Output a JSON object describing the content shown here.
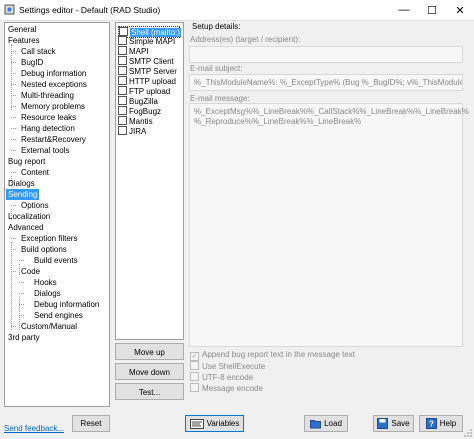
{
  "window": {
    "title": "Settings editor - Default (RAD Studio)"
  },
  "tree": {
    "items": [
      "General",
      "Features",
      "Call stack",
      "BugID",
      "Debug information",
      "Nested exceptions",
      "Multi-threading",
      "Memory problems",
      "Resource leaks",
      "Hang detection",
      "Restart&Recovery",
      "External tools",
      "Bug report",
      "Content",
      "Dialogs",
      "Sending",
      "Options",
      "Localization",
      "Advanced",
      "Exception filters",
      "Build options",
      "Build events",
      "Code",
      "Hooks",
      "Dialogs",
      "Debug information",
      "Send engines",
      "Custom/Manual",
      "3rd party"
    ],
    "selected": "Sending"
  },
  "plugins": {
    "items": [
      "Shell (mailto:)",
      "Simple MAPI",
      "MAPI",
      "SMTP Client",
      "SMTP Server",
      "HTTP upload",
      "FTP upload",
      "BugZilla",
      "FogBugz",
      "Mantis",
      "JIRA"
    ],
    "selected": "Shell (mailto:)"
  },
  "buttons": {
    "move_up": "Move up",
    "move_down": "Move down",
    "test": "Test...",
    "reset": "Reset",
    "variables": "Variables",
    "load": "Load",
    "save": "Save",
    "help": "Help"
  },
  "setup": {
    "heading": "Setup details:",
    "address_label": "Address(es) (target / recipient):",
    "address_value": "",
    "subject_label": "E-mail subject:",
    "subject_value": "%_ThisModuleName%: %_ExceptType% (Bug %_BugID%; v%_ThisModuleVer%)",
    "message_label": "E-mail message:",
    "message_line1": "%_ExceptMsg%%_LineBreak%%_CallStack%%_LineBreak%%_LineBreak%",
    "message_line2": "%_Reproduce%%_LineBreak%%_LineBreak%"
  },
  "options": [
    {
      "label": "Append bug report text in the message text",
      "checked": true
    },
    {
      "label": "Use ShellExecute",
      "checked": false
    },
    {
      "label": "UTF-8 encode",
      "checked": false
    },
    {
      "label": "Message encode",
      "checked": false
    }
  ],
  "footer": {
    "feedback_link": "Send feedback..."
  },
  "colors": {
    "selection": "#3399ff",
    "link": "#0066cc",
    "focus_border": "#0078d7"
  }
}
